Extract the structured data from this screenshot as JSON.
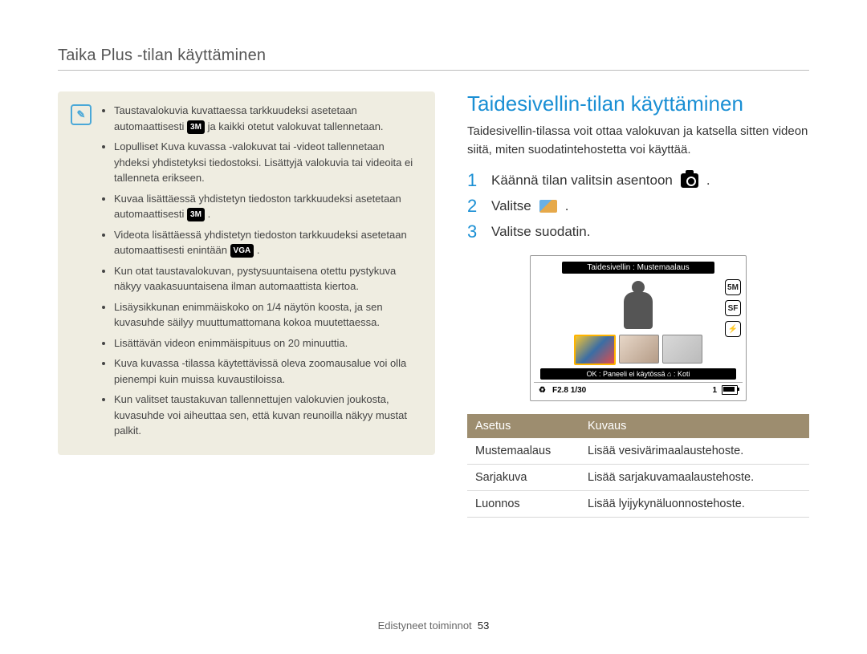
{
  "header": {
    "running_title": "Taika Plus -tilan käyttäminen"
  },
  "note": {
    "items": [
      {
        "pre": "Taustavalokuvia kuvattaessa tarkkuudeksi asetetaan automaattisesti ",
        "badge": "3M",
        "post": " ja kaikki otetut valokuvat tallennetaan."
      },
      {
        "pre": "Lopulliset Kuva kuvassa -valokuvat tai -videot tallennetaan yhdeksi yhdistetyksi tiedostoksi. Lisättyjä valokuvia tai videoita ei tallenneta erikseen."
      },
      {
        "pre": "Kuvaa lisättäessä yhdistetyn tiedoston tarkkuudeksi asetetaan automaattisesti ",
        "badge": "3M",
        "post": "."
      },
      {
        "pre": "Videota lisättäessä yhdistetyn tiedoston tarkkuudeksi asetetaan automaattisesti enintään ",
        "badge": "VGA",
        "post": "."
      },
      {
        "pre": "Kun otat taustavalokuvan, pystysuuntaisena otettu pystykuva näkyy vaakasuuntaisena ilman automaattista kiertoa."
      },
      {
        "pre": "Lisäysikkunan enimmäiskoko on 1/4 näytön koosta, ja sen kuvasuhde säilyy muuttumattomana kokoa muutettaessa."
      },
      {
        "pre": "Lisättävän videon enimmäispituus on 20 minuuttia."
      },
      {
        "pre": "Kuva kuvassa -tilassa käytettävissä oleva zoomausalue voi olla pienempi kuin muissa kuvaustiloissa."
      },
      {
        "pre": "Kun valitset taustakuvan tallennettujen valokuvien joukosta, kuvasuhde voi aiheuttaa sen, että kuvan reunoilla näkyy mustat palkit."
      }
    ]
  },
  "right": {
    "title": "Taidesivellin-tilan käyttäminen",
    "intro": "Taidesivellin-tilassa voit ottaa valokuvan ja katsella sitten videon siitä, miten suodatintehostetta voi käyttää.",
    "steps": {
      "s1_num": "1",
      "s1_text": "Käännä tilan valitsin asentoon",
      "s2_num": "2",
      "s2_text_pre": "Valitse",
      "s3_num": "3",
      "s3_text": "Valitse suodatin."
    },
    "lcd": {
      "top_label": "Taidesivellin : Mustemaalaus",
      "side_5m": "5M",
      "side_sf": "SF",
      "bottom_hint": "OK : Paneeli ei käytössä     ⌂ : Koti",
      "status_left": "F2.8  1/30",
      "status_right": "1"
    },
    "table": {
      "head_setting": "Asetus",
      "head_desc": "Kuvaus",
      "rows": [
        {
          "name": "Mustemaalaus",
          "desc": "Lisää vesivärimaalaustehoste."
        },
        {
          "name": "Sarjakuva",
          "desc": "Lisää sarjakuvamaalaustehoste."
        },
        {
          "name": "Luonnos",
          "desc": "Lisää lyijykynäluonnostehoste."
        }
      ]
    }
  },
  "footer": {
    "section": "Edistyneet toiminnot",
    "page": "53"
  }
}
